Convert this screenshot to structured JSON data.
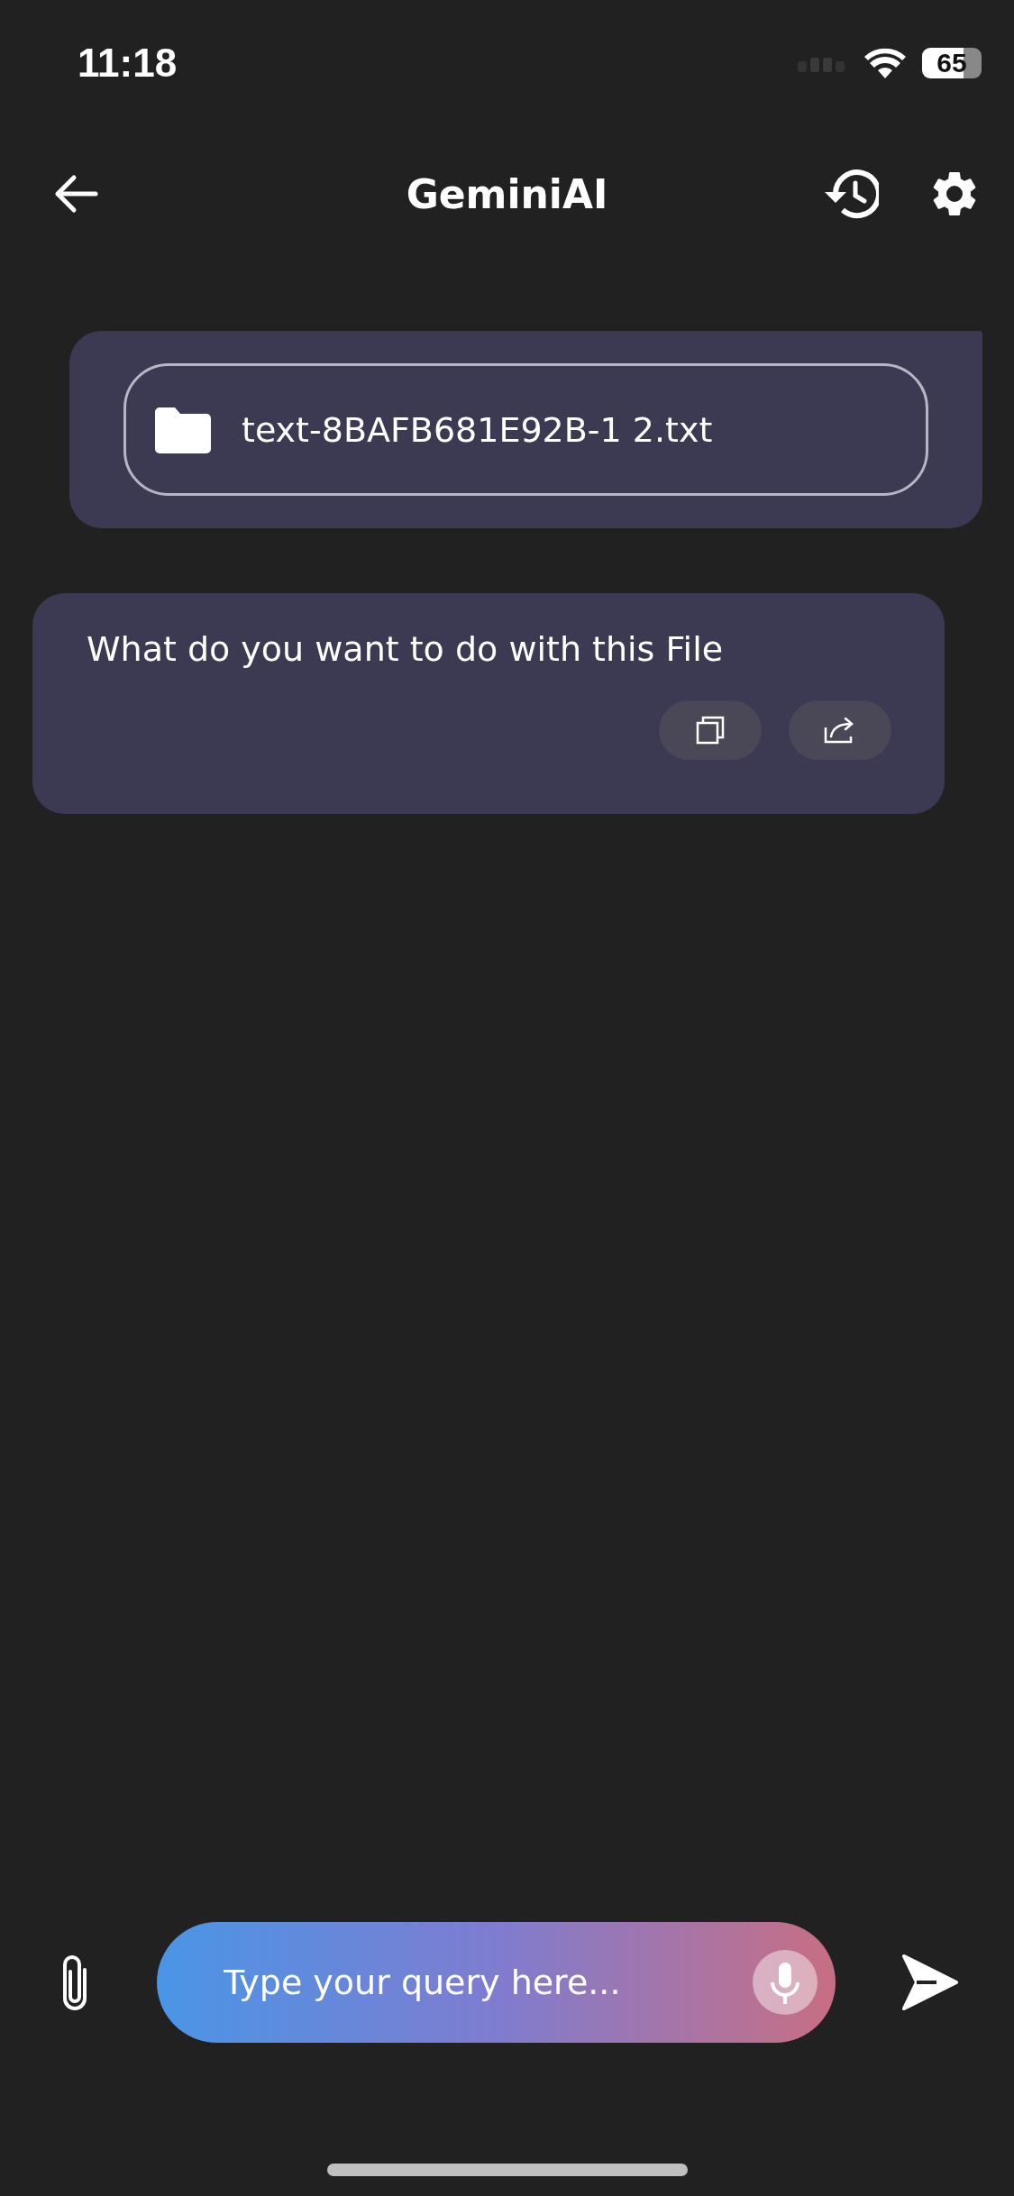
{
  "status_bar": {
    "time": "11:18",
    "battery": "65"
  },
  "header": {
    "title": "GeminiAI"
  },
  "messages": [
    {
      "kind": "file",
      "outgoing": true,
      "file_name": "text-8BAFB681E92B-1 2.txt"
    },
    {
      "kind": "text",
      "outgoing": false,
      "text": "What do you want to do with this File"
    }
  ],
  "composer": {
    "placeholder": "Type your query here..."
  }
}
